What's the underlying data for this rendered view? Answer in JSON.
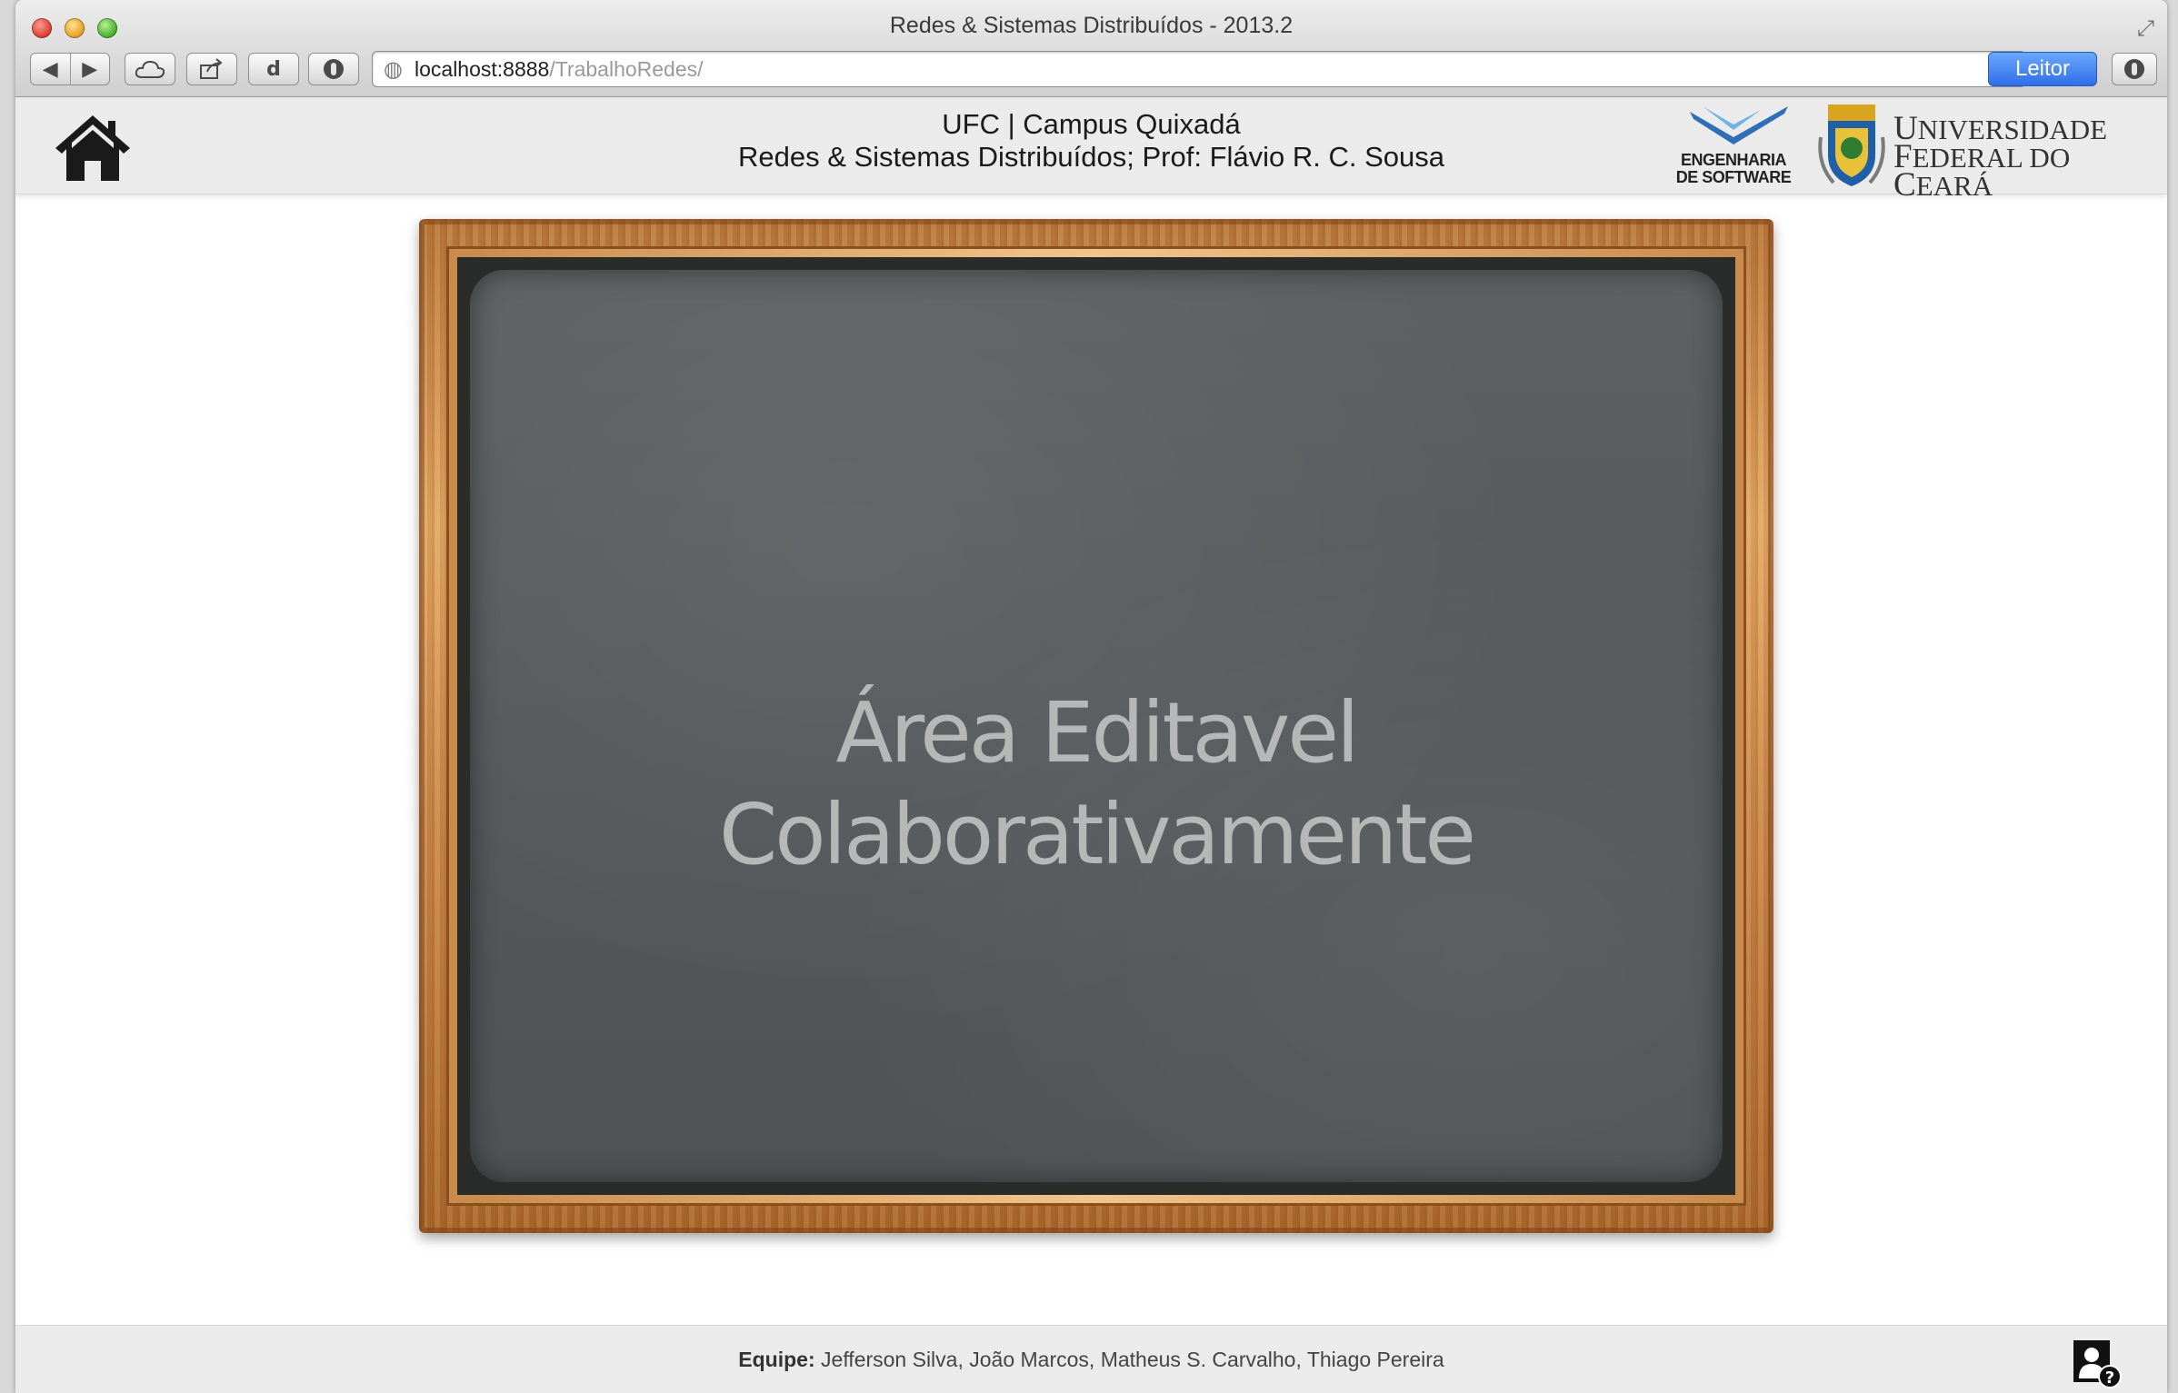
{
  "window": {
    "title": "Redes & Sistemas Distribuídos - 2013.2"
  },
  "toolbar": {
    "url_host": "localhost:8888",
    "url_path": "/TrabalhoRedes/",
    "reader_label": "Leitor",
    "d_label": "d"
  },
  "header": {
    "line1": "UFC | Campus Quixadá",
    "line2": "Redes & Sistemas Distribuídos; Prof: Flávio R. C. Sousa",
    "eng_logo_line1": "ENGENHARIA",
    "eng_logo_line2": "DE SOFTWARE",
    "ufc_line1_initial": "U",
    "ufc_line1_rest": "NIVERSIDADE",
    "ufc_line2_initial": "F",
    "ufc_line2_rest": "EDERAL DO ",
    "ufc_line2_initial2": "C",
    "ufc_line2_rest2": "EARÁ"
  },
  "board": {
    "line1": "Área Editavel",
    "line2": "Colaborativamente"
  },
  "footer": {
    "team_label": "Equipe:",
    "members": "Jefferson Silva,  João Marcos,  Matheus S. Carvalho,  Thiago Pereira"
  },
  "colors": {
    "reader_blue": "#3c7cf0",
    "slate": "#55595b",
    "frame_wood": "#d79a58"
  }
}
